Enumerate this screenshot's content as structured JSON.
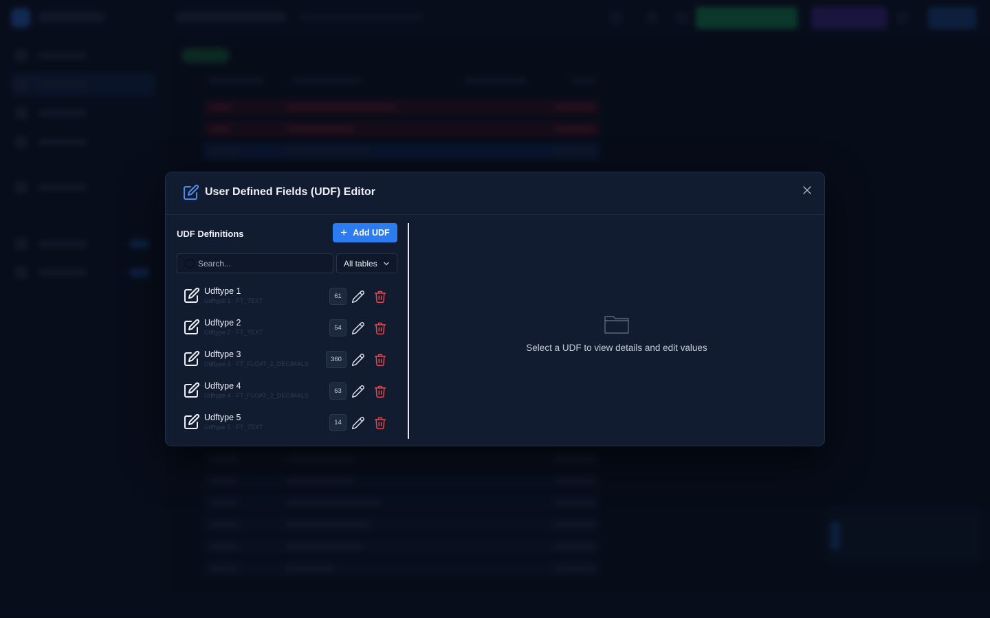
{
  "modal": {
    "title": "User Defined Fields (UDF) Editor",
    "close_icon": "close-icon",
    "header_icon": "edit-square-icon"
  },
  "left_panel": {
    "title": "UDF Definitions",
    "add_button_label": "Add UDF",
    "search": {
      "placeholder": "Search...",
      "value": ""
    },
    "table_filter": {
      "selected": "All tables"
    }
  },
  "udfs": [
    {
      "name": "Udftype 1",
      "subtitle": "Udftype 1 · FT_TEXT",
      "count": "61"
    },
    {
      "name": "Udftype 2",
      "subtitle": "Udftype 2 · FT_TEXT",
      "count": "54"
    },
    {
      "name": "Udftype 3",
      "subtitle": "Udftype 3 · FT_FLOAT_2_DECIMALS",
      "count": "360"
    },
    {
      "name": "Udftype 4",
      "subtitle": "Udftype 4 · FT_FLOAT_2_DECIMALS",
      "count": "63"
    },
    {
      "name": "Udftype 5",
      "subtitle": "Udftype 5 · FT_TEXT",
      "count": "14"
    }
  ],
  "right_panel": {
    "empty_icon": "folder-icon",
    "empty_message": "Select a UDF to view details and edit values"
  },
  "colors": {
    "accent": "#2b7cf0",
    "danger": "#e5484d",
    "modal_bg": "#121c30",
    "page_bg": "#0a1020"
  }
}
